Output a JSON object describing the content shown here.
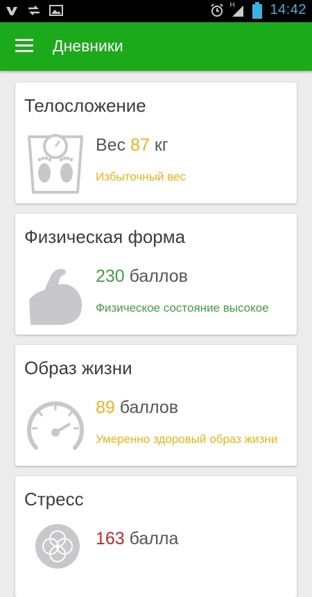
{
  "status_bar": {
    "time": "14:42",
    "network": "H",
    "left_icons": [
      "vk-icon",
      "sync-icon",
      "image-icon"
    ],
    "right_icons": [
      "alarm-icon",
      "signal-icon",
      "battery-icon"
    ]
  },
  "app_bar": {
    "title": "Дневники",
    "color": "#1aaa1a"
  },
  "cards": [
    {
      "title": "Телосложение",
      "icon": "scale-icon",
      "prefix": "Вес",
      "value": "87",
      "unit": "кг",
      "value_color": "#f6b20f",
      "description": "Избыточный вес",
      "description_color": "#f6b20f"
    },
    {
      "title": "Физическая форма",
      "icon": "muscle-icon",
      "value": "230",
      "unit": "баллов",
      "value_color": "#3ea33e",
      "description": "Физическое состояние высокое",
      "description_color": "#3ea33e"
    },
    {
      "title": "Образ жизни",
      "icon": "speedometer-icon",
      "value": "89",
      "unit": "баллов",
      "value_color": "#f6b20f",
      "description": "Умеренно здоровый образ жизни",
      "description_color": "#f6b20f"
    },
    {
      "title": "Стресс",
      "icon": "stress-icon",
      "value": "163",
      "unit": "балла",
      "value_color": "#d62020"
    }
  ]
}
